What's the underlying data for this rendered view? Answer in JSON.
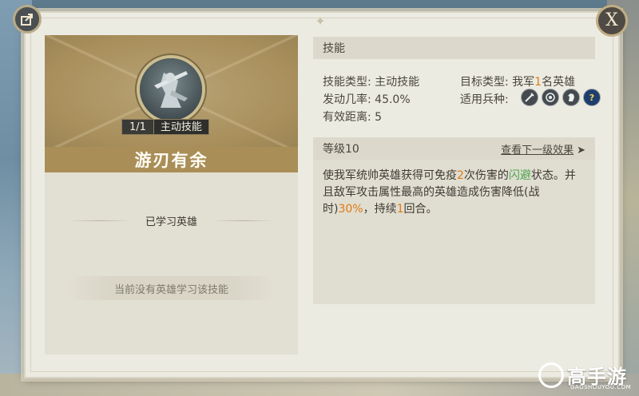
{
  "skill": {
    "level_progress": "1/1",
    "type_tag": "主动技能",
    "name": "游刃有余"
  },
  "left": {
    "learned_label": "已学习英雄",
    "no_hero_text": "当前没有英雄学习该技能"
  },
  "skill_section": {
    "title": "技能",
    "type_label": "技能类型:",
    "type_value": "主动技能",
    "rate_label": "发动几率:",
    "rate_value": "45.0%",
    "range_label": "有效距离:",
    "range_value": "5",
    "target_label": "目标类型:",
    "target_prefix": "我军",
    "target_num": "1",
    "target_suffix": "名英雄",
    "troop_label": "适用兵种:",
    "troop_icons": [
      "sword-icon",
      "target-icon",
      "horse-icon",
      "question-icon"
    ]
  },
  "level_section": {
    "title": "等级10",
    "next_link": "查看下一级效果",
    "arrow": "➤"
  },
  "description": {
    "p1": "使我军统帅英雄获得可免疫",
    "n1": "2",
    "p2": "次伤害的",
    "g1": "闪避",
    "p3": "状态。并且敌军攻击属性最高的英雄造成伤害降低(战时)",
    "n2": "30%",
    "p4": "，持续",
    "n3": "1",
    "p5": "回合。"
  },
  "buttons": {
    "close_label": "X"
  },
  "watermark": {
    "cn": "高手游",
    "en": "GAOSHOUYOU.COM"
  },
  "colors": {
    "highlight_orange": "#e07a12",
    "highlight_green": "#4aa64e",
    "gold_bar": "#a98e58"
  }
}
